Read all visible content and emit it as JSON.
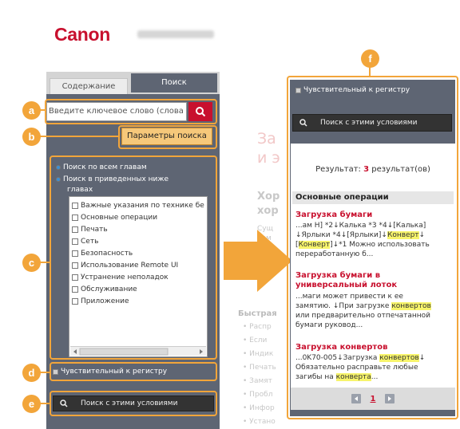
{
  "left": {
    "logo": "Canon",
    "tabs": {
      "contents": "Содержание",
      "search": "Поиск"
    },
    "search_placeholder": "Введите ключевое слово (слова",
    "params_button": "Параметры поиска",
    "scope_all": "Поиск по всем главам",
    "scope_selected_line1": "Поиск в приведенных ниже",
    "scope_selected_line2": "главах",
    "chapters": [
      "Важные указания по технике бе",
      "Основные операции",
      "Печать",
      "Сеть",
      "Безопасность",
      "Использование Remote UI",
      "Устранение неполадок",
      "Обслуживание",
      "Приложение"
    ],
    "case_sensitive": "Чувствительный к регистру",
    "search_conditions": "Поиск с этими условиями"
  },
  "callouts": {
    "a": "a",
    "b": "b",
    "c": "c",
    "d": "d",
    "e": "e",
    "f": "f"
  },
  "background": {
    "title_l1": "За",
    "title_l2": "и э",
    "sub_l1": "Хор",
    "sub_l2": "хор",
    "faint_l1": "Сущ",
    "faint_l2": "Тем",
    "quick": "Быстрая",
    "bullets": [
      "Распр",
      "Если",
      "Индик",
      "Печать",
      "Замят",
      "Пробл",
      "Инфор",
      "Устано"
    ]
  },
  "right": {
    "case_sensitive": "Чувствительный к регистру",
    "search_conditions": "Поиск с этими условиями",
    "results_prefix": "Результат:",
    "results_num": "3",
    "results_suffix": "результат(ов)",
    "section": "Основные операции",
    "r1_title": "Загрузка бумаги",
    "r1_l1": "...ам Н] *2↓Калька *3 *4↓[Калька]",
    "r1_l2a": "↓Ярлыки *4↓[Ярлыки]↓",
    "r1_l2b": "Конверт",
    "r1_l2c": "↓",
    "r1_l3a": "[",
    "r1_l3b": "Конверт",
    "r1_l3c": "]↓*1 Можно использовать",
    "r1_l4": "переработанную б...",
    "r2_title_l1": "Загрузка бумаги в",
    "r2_title_l2": "универсальный лоток",
    "r2_l1": "...маги может привести к ее",
    "r2_l2a": "замятию. ↓При загрузке ",
    "r2_l2b": "конвертов",
    "r2_l3": "или предварительно отпечатанной",
    "r2_l4": "бумаги руковод...",
    "r3_title": "Загрузка конвертов",
    "r3_l1a": "...0K70-005↓Загрузка ",
    "r3_l1b": "конвертов",
    "r3_l1c": "↓",
    "r3_l2": "Обязательно расправьте любые",
    "r3_l3a": "загибы на ",
    "r3_l3b": "конверта",
    "r3_l3c": "...",
    "page": "1"
  }
}
